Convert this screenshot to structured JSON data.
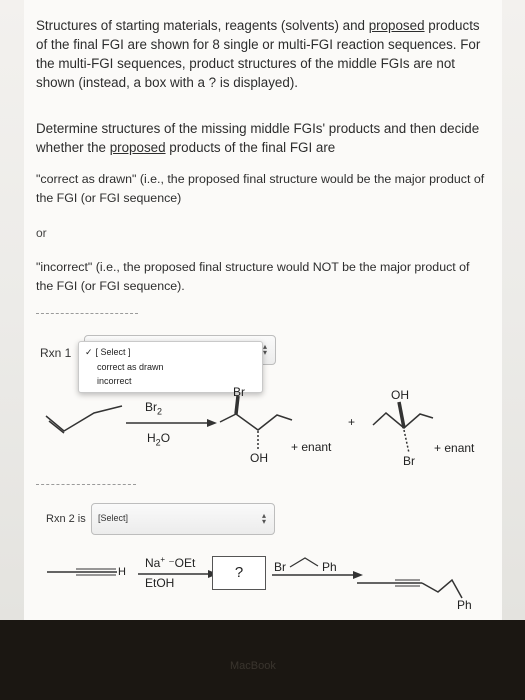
{
  "intro": {
    "text_before": "Structures of starting materials, reagents (solvents) and ",
    "proposed_word": "proposed",
    "text_after": " products of the final FGI are shown for 8 single or multi-FGI reaction sequences. For the multi-FGI sequences, product structures of the middle FGIs are not shown (instead, a box with a ? is displayed)."
  },
  "instruction": {
    "text_before": "Determine structures of the missing middle FGIs' products and then decide whether the ",
    "proposed_word": "proposed",
    "text_after": " products of the final FGI are"
  },
  "correct_def": "\"correct as drawn\" (i.e., the proposed final structure would be the major product of the FGI (or FGI sequence)",
  "or_text": "or",
  "incorrect_def": "\"incorrect\" (i.e., the proposed final structure would NOT be the major product of the FGI (or FGI sequence).",
  "rxn1": {
    "label": "Rxn 1",
    "dropdown_options": [
      "[ Select ]",
      "correct as drawn",
      "incorrect"
    ],
    "check_mark": "✓",
    "reagent_top_main": "Br",
    "reagent_top_sub": "2",
    "reagent_bottom_main": "H",
    "reagent_bottom_sub": "2",
    "reagent_bottom_tail": "O",
    "product1_top": "Br",
    "product1_bottom": "OH",
    "product1_enant": "+ enant",
    "plus": "+",
    "product2_top": "OH",
    "product2_bottom": "Br",
    "product2_enant": "+ enant"
  },
  "rxn2": {
    "label": "Rxn 2 is",
    "select_value": "[Select]",
    "h_label": "H",
    "reagent1_top_main": "Na",
    "reagent1_top_sup": "+",
    "reagent1_top_tail": " ⁻OEt",
    "reagent1_bottom": "EtOH",
    "question": "?",
    "reagent2_left": "Br",
    "reagent2_right": "Ph",
    "product_label": "Ph"
  },
  "bezel": {
    "brand": "MacBook"
  }
}
